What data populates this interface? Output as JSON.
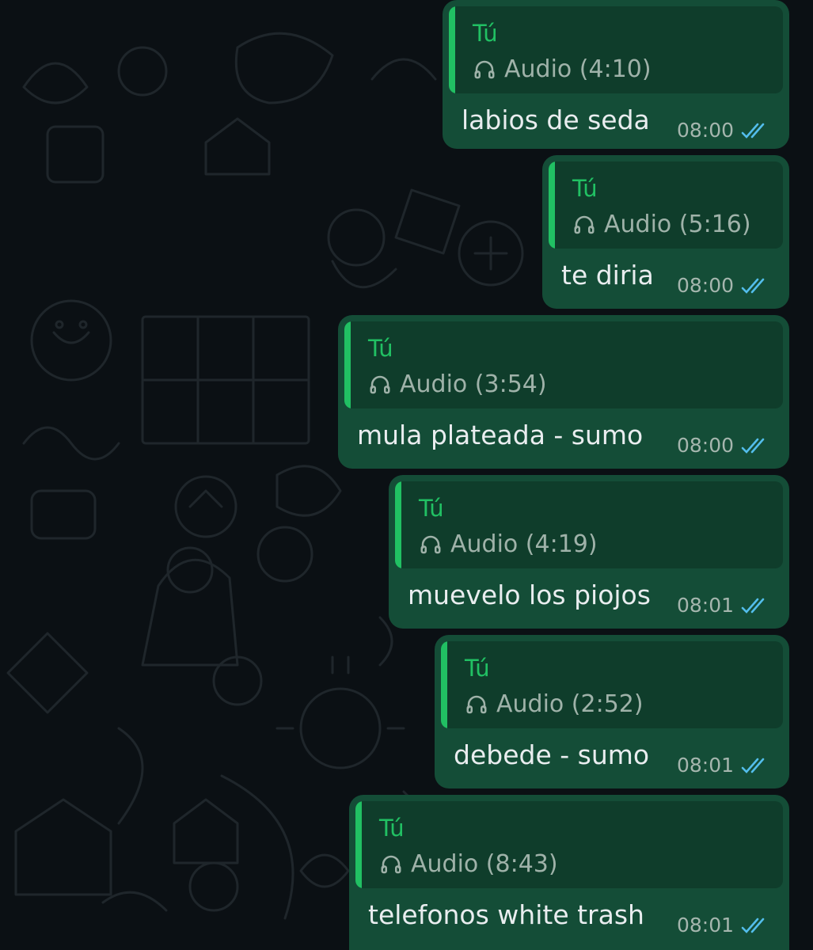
{
  "colors": {
    "background": "#0b1014",
    "bubble": "#144d37",
    "quote_bg": "#0f3d2b",
    "quote_bar": "#21c063",
    "read_ticks": "#53bdeb"
  },
  "messages": [
    {
      "quote_author": "Tú",
      "quote_icon": "headphones-icon",
      "quote_text": "Audio (4:10)",
      "text": "labios de seda",
      "time": "08:00",
      "status": "read"
    },
    {
      "quote_author": "Tú",
      "quote_icon": "headphones-icon",
      "quote_text": "Audio (5:16)",
      "text": "te diria",
      "time": "08:00",
      "status": "read"
    },
    {
      "quote_author": "Tú",
      "quote_icon": "headphones-icon",
      "quote_text": "Audio (3:54)",
      "text": "mula plateada - sumo",
      "time": "08:00",
      "status": "read"
    },
    {
      "quote_author": "Tú",
      "quote_icon": "headphones-icon",
      "quote_text": "Audio (4:19)",
      "text": "muevelo los piojos",
      "time": "08:01",
      "status": "read"
    },
    {
      "quote_author": "Tú",
      "quote_icon": "headphones-icon",
      "quote_text": "Audio (2:52)",
      "text": "debede - sumo",
      "time": "08:01",
      "status": "read"
    },
    {
      "quote_author": "Tú",
      "quote_icon": "headphones-icon",
      "quote_text": "Audio (8:43)",
      "text": "telefonos white trash",
      "time": "08:01",
      "status": "read"
    }
  ]
}
